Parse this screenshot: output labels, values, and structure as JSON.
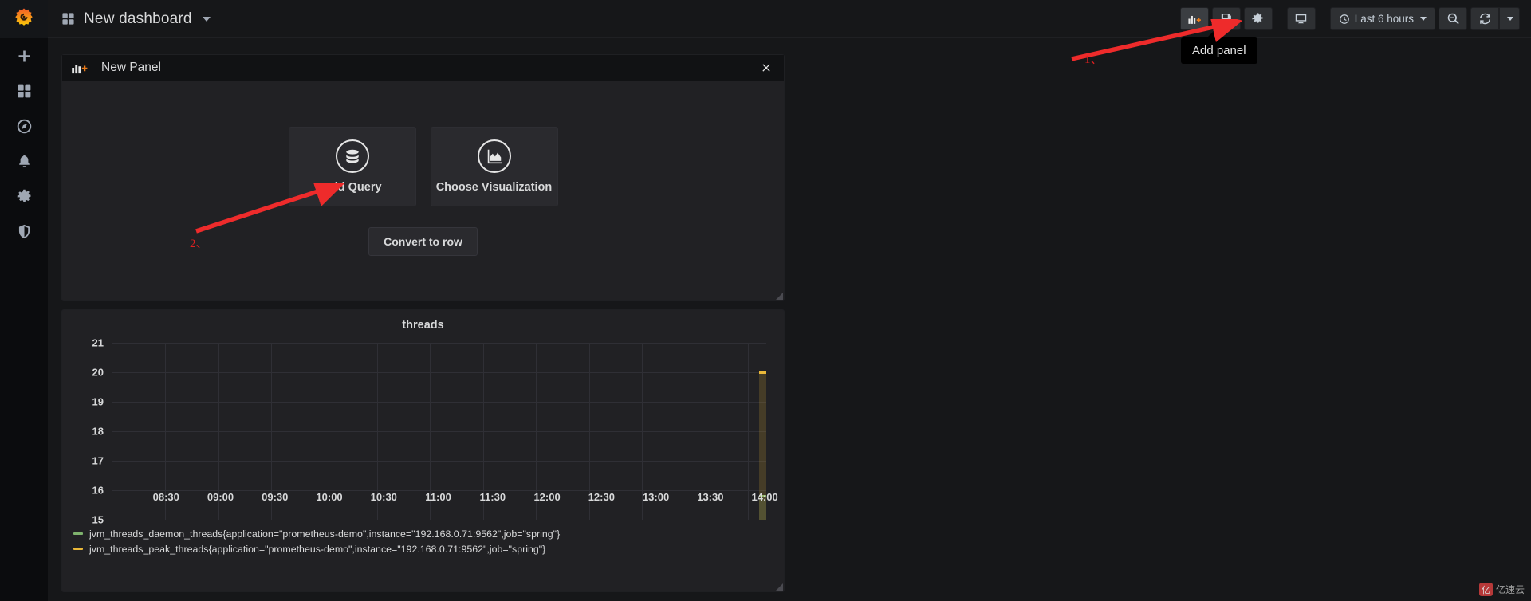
{
  "app": {
    "brand_icon": "grafana-logo",
    "background": "#161719"
  },
  "sidebar": {
    "items": [
      {
        "name": "create",
        "icon": "plus-icon",
        "label": "Create"
      },
      {
        "name": "dashboards",
        "icon": "dashboards-icon",
        "label": "Dashboards"
      },
      {
        "name": "explore",
        "icon": "compass-icon",
        "label": "Explore"
      },
      {
        "name": "alerting",
        "icon": "bell-icon",
        "label": "Alerting"
      },
      {
        "name": "configuration",
        "icon": "gear-icon",
        "label": "Configuration"
      },
      {
        "name": "server-admin",
        "icon": "shield-icon",
        "label": "Server Admin"
      }
    ]
  },
  "topnav": {
    "dashboard_icon": "dashboard-grid-icon",
    "title": "New dashboard",
    "buttons": [
      {
        "name": "add-panel",
        "icon": "add-panel-icon",
        "label": "Add panel",
        "active": true
      },
      {
        "name": "save-dashboard",
        "icon": "save-icon",
        "label": "Save dashboard",
        "active": false
      },
      {
        "name": "dashboard-settings",
        "icon": "gear-icon",
        "label": "Dashboard settings",
        "active": false
      },
      {
        "name": "cycle-view-mode",
        "icon": "monitor-icon",
        "label": "Cycle view mode",
        "active": false
      }
    ],
    "time_picker": {
      "icon": "clock-icon",
      "value": "Last 6 hours"
    },
    "zoom_out": {
      "icon": "zoom-out-icon",
      "label": "Zoom out time range"
    },
    "refresh": {
      "icon": "refresh-icon",
      "label": "Refresh dashboard"
    },
    "tooltip": "Add panel"
  },
  "new_panel": {
    "header_icon": "add-panel-icon",
    "title": "New Panel",
    "close_icon": "close-icon",
    "cards": [
      {
        "name": "add-query",
        "icon": "database-icon",
        "label": "Add Query"
      },
      {
        "name": "choose-visualization",
        "icon": "graph-icon",
        "label": "Choose Visualization"
      }
    ],
    "convert_label": "Convert to row"
  },
  "graph_panel": {
    "title": "threads"
  },
  "chart_data": {
    "type": "line",
    "title": "threads",
    "xlabel": "",
    "ylabel": "",
    "grid": true,
    "legend_position": "bottom",
    "ylim": [
      15,
      21
    ],
    "yticks": [
      21,
      20,
      19,
      18,
      17,
      16,
      15
    ],
    "xticks": [
      "08:30",
      "09:00",
      "09:30",
      "10:00",
      "10:30",
      "11:00",
      "11:30",
      "12:00",
      "12:30",
      "13:00",
      "13:30",
      "14:00"
    ],
    "series": [
      {
        "name": "jvm_threads_daemon_threads{application=\"prometheus-demo\",instance=\"192.168.0.71:9562\",job=\"spring\"}",
        "color": "#7eb26d",
        "value_at_end": 15.8,
        "values": [
          15.8
        ]
      },
      {
        "name": "jvm_threads_peak_threads{application=\"prometheus-demo\",instance=\"192.168.0.71:9562\",job=\"spring\"}",
        "color": "#eab839",
        "value_at_end": 20.0,
        "values": [
          20.0
        ]
      }
    ],
    "note": "Data only present at the far right edge of the time range (most recent scrape)."
  },
  "annotations": [
    {
      "name": "annotation-1",
      "label": "1、",
      "target": "add-panel-button",
      "color": "#ee2b2b"
    },
    {
      "name": "annotation-2",
      "label": "2、",
      "target": "add-query-card",
      "color": "#ee2b2b"
    }
  ],
  "watermark": {
    "badge": "亿",
    "text": "亿速云"
  }
}
